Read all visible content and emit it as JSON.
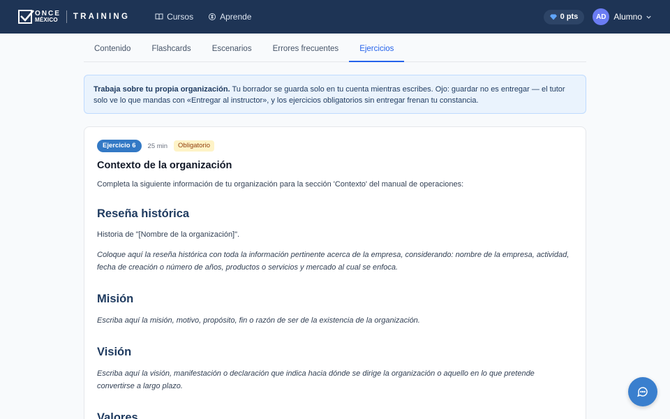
{
  "header": {
    "logo_line1": "ONCE",
    "logo_line2": "MÉXICO",
    "brand": "TRAINING",
    "nav": [
      {
        "label": "Cursos",
        "icon": "book-icon"
      },
      {
        "label": "Aprende",
        "icon": "brain-icon"
      }
    ],
    "points": "0 pts",
    "avatar_initials": "AD",
    "user_name": "Alumno"
  },
  "tabs": [
    {
      "label": "Contenido",
      "active": false
    },
    {
      "label": "Flashcards",
      "active": false
    },
    {
      "label": "Escenarios",
      "active": false
    },
    {
      "label": "Errores frecuentes",
      "active": false
    },
    {
      "label": "Ejercicios",
      "active": true
    }
  ],
  "banner": {
    "bold": "Trabaja sobre tu propia organización.",
    "text": " Tu borrador se guarda solo en tu cuenta mientras escribes. Ojo: guardar no es entregar — el tutor solo ve lo que mandas con «Entregar al instructor», y los ejercicios obligatorios sin entregar frenan tu constancia."
  },
  "exercise": {
    "badge": "Ejercicio 6",
    "duration": "25 min",
    "required": "Obligatorio",
    "title": "Contexto de la organización",
    "intro": "Completa la siguiente información de tu organización para la sección 'Contexto' del manual de operaciones:",
    "sections": [
      {
        "heading": "Reseña histórica",
        "normal": "Historia de \"[Nombre de la organización]\".",
        "italic": "Coloque aquí la reseña histórica con toda la información pertinente acerca de la empresa, considerando: nombre de la empresa, actividad, fecha de creación o número de años, productos o servicios y mercado al cual se enfoca."
      },
      {
        "heading": "Misión",
        "italic": "Escriba aquí la misión, motivo, propósito, fin o razón de ser de la existencia de la organización."
      },
      {
        "heading": "Visión",
        "italic": "Escriba aquí la visión, manifestación o declaración que indica hacia dónde se dirige la organización o aquello en lo que pretende convertirse a largo plazo."
      },
      {
        "heading": "Valores"
      }
    ]
  },
  "colors": {
    "header_bg": "#1e3455",
    "accent": "#2563eb",
    "badge_blue": "#3379c5",
    "heading": "#1e3a5f"
  }
}
